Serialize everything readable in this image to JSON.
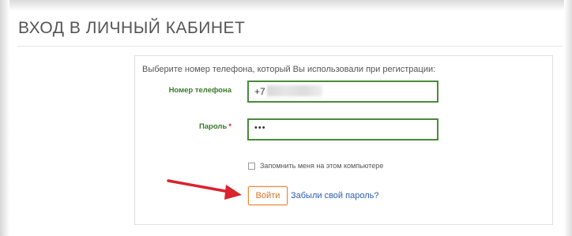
{
  "page": {
    "title": "Вход в личный кабинет"
  },
  "form": {
    "instruction": "Выберите номер телефона, который Вы использовали при регистрации:",
    "phone": {
      "label": "Номер телефона",
      "prefix": "+7"
    },
    "password": {
      "label": "Пароль",
      "required_mark": "*",
      "value": "•••"
    },
    "remember": {
      "label": "Запомнить меня на этом компьютере",
      "checked": false
    },
    "login_button": "Войти",
    "forgot_link": "Забыли свой пароль?"
  },
  "annotation": {
    "arrow_color": "#d9232e",
    "pointing_to": "login-button"
  },
  "colors": {
    "label_green": "#3a7a2a",
    "field_border": "#4a8a3a",
    "button_orange": "#e07020",
    "link_blue": "#2a5db0",
    "required_red": "#d9232e"
  }
}
